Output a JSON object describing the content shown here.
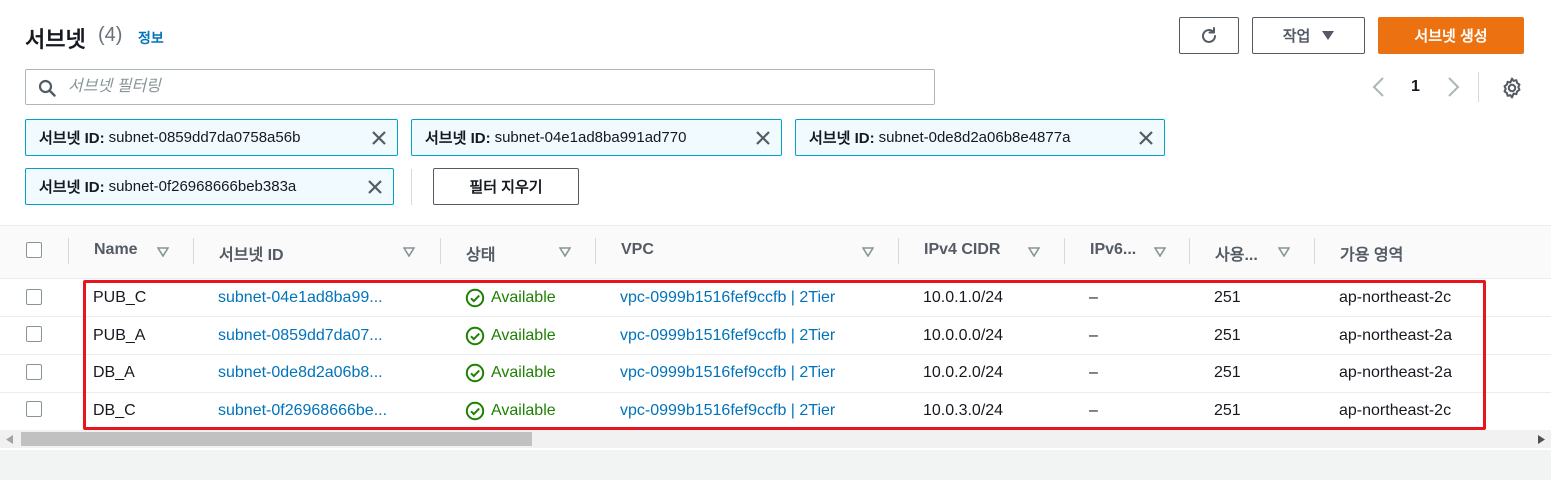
{
  "header": {
    "title": "서브넷",
    "count": "(4)",
    "info_link": "정보",
    "actions_label": "작업",
    "create_label": "서브넷 생성"
  },
  "search": {
    "placeholder": "서브넷 필터링"
  },
  "pagination": {
    "current_page": "1"
  },
  "filter_tokens": [
    {
      "key": "서브넷 ID:",
      "value": "subnet-0859dd7da0758a56b"
    },
    {
      "key": "서브넷 ID:",
      "value": "subnet-04e1ad8ba991ad770"
    },
    {
      "key": "서브넷 ID:",
      "value": "subnet-0de8d2a06b8e4877a"
    },
    {
      "key": "서브넷 ID:",
      "value": "subnet-0f26968666beb383a"
    }
  ],
  "clear_filters_label": "필터 지우기",
  "table": {
    "columns": [
      "Name",
      "서브넷 ID",
      "상태",
      "VPC",
      "IPv4 CIDR",
      "IPv6...",
      "사용...",
      "가용 영역"
    ],
    "rows": [
      {
        "name": "PUB_C",
        "subnet_id": "subnet-04e1ad8ba99...",
        "status": "Available",
        "vpc": "vpc-0999b1516fef9ccfb | 2Tier",
        "ipv4": "10.0.1.0/24",
        "ipv6": "–",
        "available_ips": "251",
        "az": "ap-northeast-2c"
      },
      {
        "name": "PUB_A",
        "subnet_id": "subnet-0859dd7da07...",
        "status": "Available",
        "vpc": "vpc-0999b1516fef9ccfb | 2Tier",
        "ipv4": "10.0.0.0/24",
        "ipv6": "–",
        "available_ips": "251",
        "az": "ap-northeast-2a"
      },
      {
        "name": "DB_A",
        "subnet_id": "subnet-0de8d2a06b8...",
        "status": "Available",
        "vpc": "vpc-0999b1516fef9ccfb | 2Tier",
        "ipv4": "10.0.2.0/24",
        "ipv6": "–",
        "available_ips": "251",
        "az": "ap-northeast-2a"
      },
      {
        "name": "DB_C",
        "subnet_id": "subnet-0f26968666be...",
        "status": "Available",
        "vpc": "vpc-0999b1516fef9ccfb | 2Tier",
        "ipv4": "10.0.3.0/24",
        "ipv6": "–",
        "available_ips": "251",
        "az": "ap-northeast-2c"
      }
    ]
  },
  "colors": {
    "primary_orange": "#ec7211",
    "link_blue": "#0073bb",
    "status_green": "#1d8102",
    "highlight_red": "#e8141e",
    "token_border": "#00a1c9"
  },
  "icons": {
    "refresh": "refresh-icon",
    "dropdown": "caret-down-icon",
    "search": "search-icon",
    "settings": "gear-icon",
    "remove_token": "close-icon",
    "status": "check-circle-icon"
  }
}
